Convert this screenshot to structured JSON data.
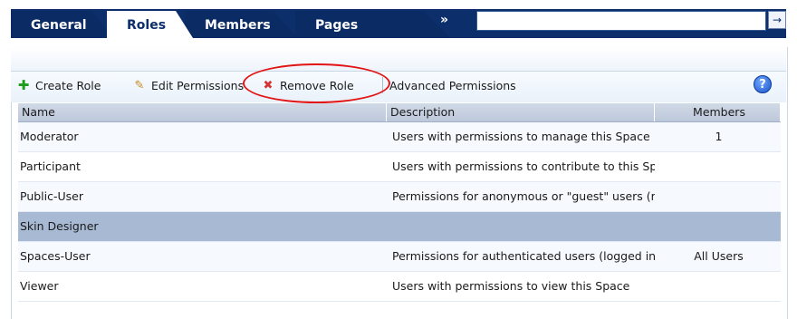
{
  "tabs": [
    {
      "label": "General",
      "active": false
    },
    {
      "label": "Roles",
      "active": true
    },
    {
      "label": "Members",
      "active": false
    },
    {
      "label": "Pages",
      "active": false
    }
  ],
  "tab_overflow": "»",
  "tab_go": "→",
  "toolbar": {
    "create_role": "Create Role",
    "edit_permissions": "Edit Permissions",
    "remove_role": "Remove Role",
    "advanced_permissions": "Advanced Permissions",
    "help": "?"
  },
  "table": {
    "headers": {
      "name": "Name",
      "description": "Description",
      "members": "Members"
    },
    "rows": [
      {
        "name": "Moderator",
        "description": "Users with permissions to manage this Space",
        "members": "1"
      },
      {
        "name": "Participant",
        "description": "Users with permissions to contribute to this Sp",
        "members": ""
      },
      {
        "name": "Public-User",
        "description": "Permissions for anonymous or \"guest\" users (r",
        "members": ""
      },
      {
        "name": "Skin Designer",
        "description": "",
        "members": ""
      },
      {
        "name": "Spaces-User",
        "description": "Permissions for authenticated users (logged in",
        "members": "All Users"
      },
      {
        "name": "Viewer",
        "description": "Users with permissions to view this Space",
        "members": ""
      }
    ],
    "selected_row": "Skin Designer"
  },
  "colors": {
    "tab_bar": "#0c2e6b",
    "selected_row": "#a8bad3",
    "annotation": "#e21414"
  }
}
